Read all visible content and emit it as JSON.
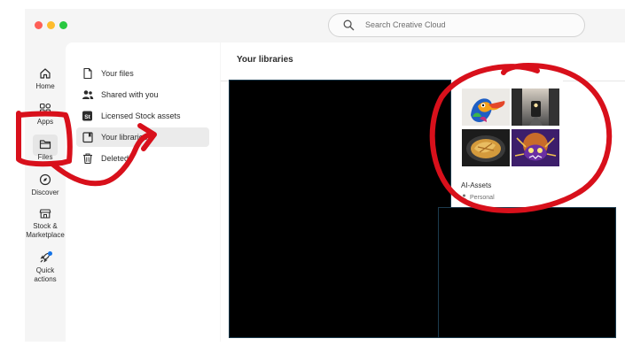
{
  "search": {
    "placeholder": "Search Creative Cloud"
  },
  "rail": {
    "home": "Home",
    "apps": "Apps",
    "files": "Files",
    "discover": "Discover",
    "stock_line1": "Stock &",
    "stock_line2": "Marketplace",
    "quick_line1": "Quick",
    "quick_line2": "actions"
  },
  "files_nav": [
    {
      "label": "Your files",
      "icon": "file-icon"
    },
    {
      "label": "Shared with you",
      "icon": "shared-users-icon"
    },
    {
      "label": "Licensed Stock assets",
      "icon": "stock-st-icon"
    },
    {
      "label": "Your libraries",
      "icon": "library-icon",
      "selected": true
    },
    {
      "label": "Deleted",
      "icon": "trash-icon"
    }
  ],
  "main": {
    "title": "Your libraries"
  },
  "library_card": {
    "name": "AI-Assets",
    "owner": "Personal"
  },
  "colors": {
    "annotation": "#d8101b",
    "selected_bg": "#ebebeb",
    "accent_badge": "#1473e6"
  }
}
